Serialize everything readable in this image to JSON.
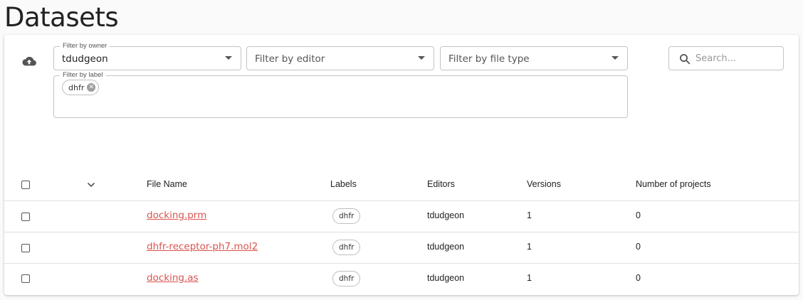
{
  "page": {
    "title": "Datasets"
  },
  "toolbar": {
    "upload_icon": "cloud-upload-icon"
  },
  "filters": {
    "owner": {
      "legend": "Filter by owner",
      "value": "tdudgeon"
    },
    "editor": {
      "placeholder": "Filter by editor"
    },
    "file_type": {
      "placeholder": "Filter by file type"
    },
    "label": {
      "legend": "Filter by label",
      "chips": [
        "dhfr"
      ]
    }
  },
  "search": {
    "placeholder": "Search...",
    "icon": "search-icon"
  },
  "table": {
    "headers": [
      "File Name",
      "Labels",
      "Editors",
      "Versions",
      "Number of projects"
    ],
    "rows": [
      {
        "file_name": "docking.prm",
        "label": "dhfr",
        "editor": "tdudgeon",
        "versions": "1",
        "projects": "0"
      },
      {
        "file_name": "dhfr-receptor-ph7.mol2",
        "label": "dhfr",
        "editor": "tdudgeon",
        "versions": "1",
        "projects": "0"
      },
      {
        "file_name": "docking.as",
        "label": "dhfr",
        "editor": "tdudgeon",
        "versions": "1",
        "projects": "0"
      }
    ]
  },
  "colors": {
    "link": "#d9534f",
    "border": "#c4c4c4"
  }
}
